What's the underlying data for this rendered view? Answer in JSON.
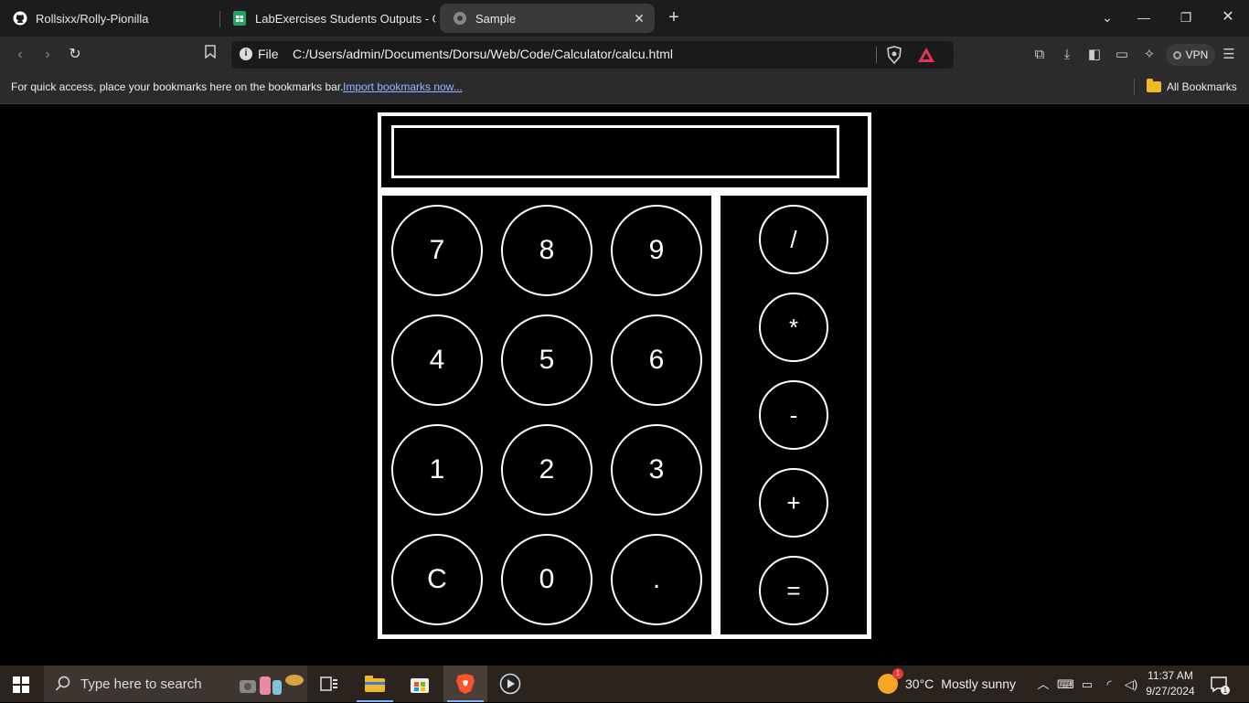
{
  "browser": {
    "tabs": [
      {
        "title": "Rollsixx/Rolly-Pionilla",
        "icon": "github-icon"
      },
      {
        "title": "LabExercises Students Outputs - Go",
        "icon": "google-sheets-icon"
      },
      {
        "title": "Sample",
        "icon": "globe-icon"
      }
    ],
    "address_scheme": "File",
    "address_url": "C:/Users/admin/Documents/Dorsu/Web/Code/Calculator/calcu.html",
    "vpn_label": "VPN",
    "bookmarks_bar_text": "For quick access, place your bookmarks here on the bookmarks bar.",
    "import_bookmarks_link": "Import bookmarks now...",
    "all_bookmarks_label": "All Bookmarks"
  },
  "calculator": {
    "display_value": "",
    "digit_keys": [
      "7",
      "8",
      "9",
      "4",
      "5",
      "6",
      "1",
      "2",
      "3",
      "C",
      "0",
      "."
    ],
    "operator_keys": [
      "/",
      "*",
      "-",
      "+",
      "="
    ]
  },
  "taskbar": {
    "search_placeholder": "Type here to search",
    "weather_temp": "30°C",
    "weather_desc": "Mostly sunny",
    "weather_badge": "1",
    "time": "11:37 AM",
    "date": "9/27/2024",
    "notification_count": "1"
  },
  "colors": {
    "page_background": "#000000",
    "calculator_border": "#ffffff",
    "key_text": "#ffffff"
  }
}
